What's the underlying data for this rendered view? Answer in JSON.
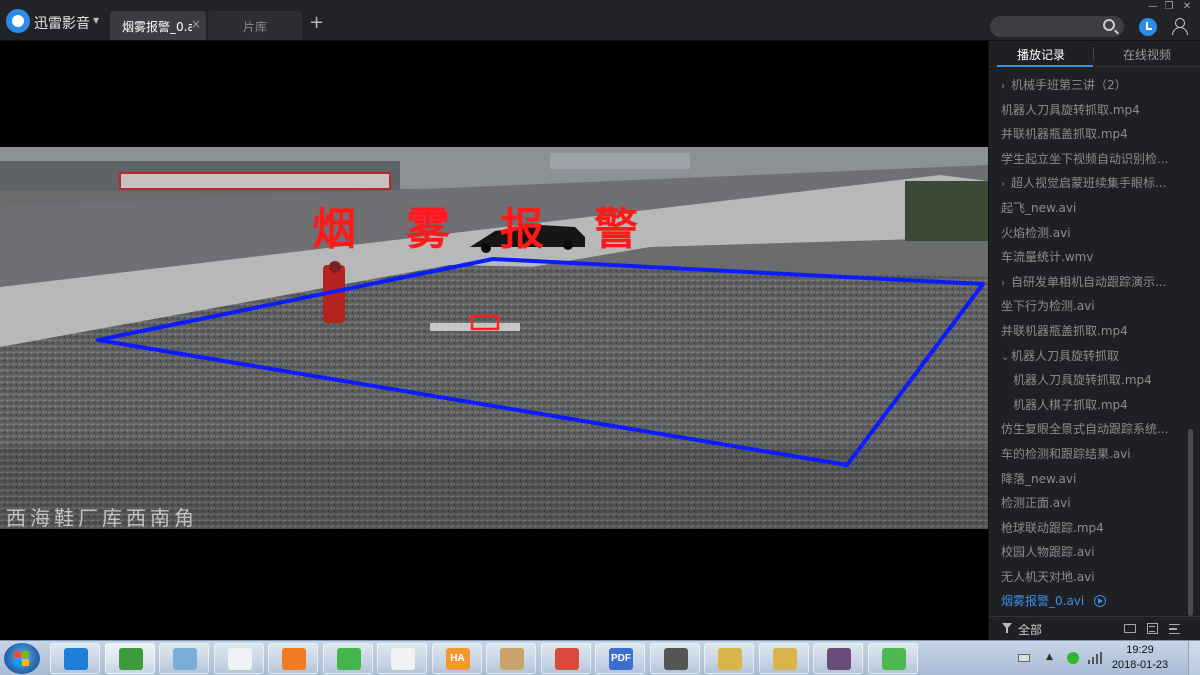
{
  "app": {
    "name": "迅雷影音",
    "tabs": [
      {
        "label": "烟雾报警_0.a",
        "close": "×"
      },
      {
        "label": "片库"
      }
    ],
    "new_tab": "+",
    "window_controls": {
      "minimize": "—",
      "maximize": "❐",
      "close": "✕"
    }
  },
  "video": {
    "overlay_text": "烟雾报警",
    "location_caption": "西海鞋厂库西南角",
    "overlay_colors": {
      "alarm_text": "#ff1a1a",
      "roi_polygon": "#0b1cff",
      "detection_box": "#ff2020"
    }
  },
  "sidebar": {
    "tabs": [
      "播放记录",
      "在线视频"
    ],
    "active_tab": 0,
    "items": [
      {
        "label": "机械手班第三讲（2）",
        "folder": true,
        "expanded": false
      },
      {
        "label": "机器人刀具旋转抓取.mp4"
      },
      {
        "label": "并联机器瓶盖抓取.mp4"
      },
      {
        "label": "学生起立坐下视频自动识别检..."
      },
      {
        "label": "超人视觉启蒙班续集手眼标...",
        "folder": true,
        "expanded": false
      },
      {
        "label": "起飞_new.avi"
      },
      {
        "label": "火焰检测.avi"
      },
      {
        "label": "车流量统计.wmv"
      },
      {
        "label": "自研发单相机自动跟踪演示...",
        "folder": true,
        "expanded": false
      },
      {
        "label": "坐下行为检测.avi"
      },
      {
        "label": "并联机器瓶盖抓取.mp4"
      },
      {
        "label": "机器人刀具旋转抓取",
        "folder": true,
        "expanded": true
      },
      {
        "label": "机器人刀具旋转抓取.mp4",
        "sub": true
      },
      {
        "label": "机器人棋子抓取.mp4",
        "sub": true
      },
      {
        "label": "仿生复眼全景式自动跟踪系统..."
      },
      {
        "label": "车的检测和跟踪结果.avi"
      },
      {
        "label": "降落_new.avi"
      },
      {
        "label": "检测正面.avi"
      },
      {
        "label": "枪球联动跟踪.mp4"
      },
      {
        "label": "校园人物跟踪.avi"
      },
      {
        "label": "无人机天对地.avi"
      },
      {
        "label": "烟雾报警_0.avi",
        "active": true
      }
    ],
    "footer": {
      "filter_label": "全部"
    }
  },
  "taskbar": {
    "apps": [
      {
        "name": "internet-explorer",
        "color": "#1f7fd6"
      },
      {
        "name": "excel-document",
        "color": "#3c9b3c",
        "active": true
      },
      {
        "name": "notepad",
        "color": "#7aaed6"
      },
      {
        "name": "blank-document",
        "color": "#f2f2f2"
      },
      {
        "name": "wps-presentation",
        "color": "#f07b24"
      },
      {
        "name": "360-browser",
        "color": "#44b54a"
      },
      {
        "name": "blank-document-2",
        "color": "#f2f2f2"
      },
      {
        "name": "ha-app",
        "color": "#f29a2e",
        "label": "HA"
      },
      {
        "name": "paint",
        "color": "#c9a46a"
      },
      {
        "name": "media-app",
        "color": "#d94a3a"
      },
      {
        "name": "pdf-reader",
        "color": "#3a6fcf",
        "label": "PDF"
      },
      {
        "name": "video-camera",
        "color": "#555555"
      },
      {
        "name": "tool-app-1",
        "color": "#d9b44a"
      },
      {
        "name": "tool-app-2",
        "color": "#d9b44a"
      },
      {
        "name": "user-avatar-app",
        "color": "#6a4c7a"
      },
      {
        "name": "clover-app",
        "color": "#4fb84f"
      }
    ],
    "clock": {
      "time": "19:29",
      "date": "2018-01-23"
    }
  }
}
